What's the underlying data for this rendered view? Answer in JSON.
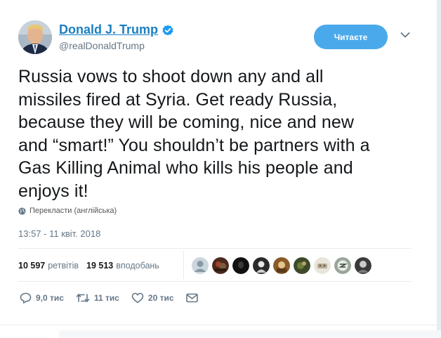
{
  "author": {
    "name": "Donald J. Trump",
    "handle": "@realDonaldTrump",
    "verified": true
  },
  "follow_button": {
    "label": "Читаєте"
  },
  "tweet": {
    "text": "Russia vows to shoot down any and all\nmissiles fired at Syria. Get ready Russia,\nbecause they will be coming, nice and new\nand “smart!” You shouldn’t be partners with a\nGas Killing Animal who kills his people and\nenjoys it!",
    "translate_label": "Перекласти (англійська)",
    "timestamp": "13:57 - 11 квіт. 2018"
  },
  "stats": {
    "retweets_count": "10 597",
    "retweets_label": "ретвітів",
    "likes_count": "19 513",
    "likes_label": "вподобань",
    "liker_avatar_count": 9
  },
  "actions": {
    "replies": "9,0 тис",
    "retweets": "11 тис",
    "likes": "20 тис"
  },
  "colors": {
    "accent": "#1b7fc1",
    "follow_button_bg": "#4aa9ea",
    "muted_text": "#657786",
    "divider": "#e6ecf0"
  },
  "icons": [
    "verified-badge-icon",
    "chevron-down-icon",
    "globe-icon",
    "reply-icon",
    "retweet-icon",
    "like-icon",
    "direct-message-icon"
  ]
}
